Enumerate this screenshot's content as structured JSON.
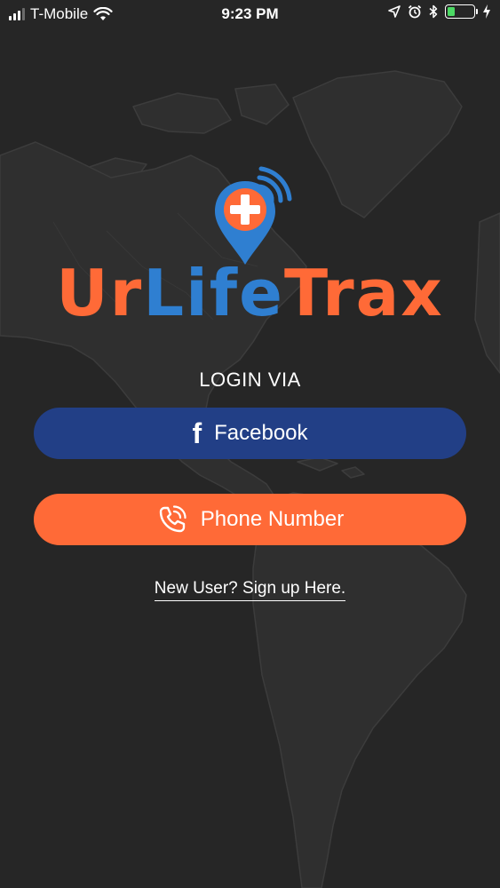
{
  "status_bar": {
    "carrier": "T-Mobile",
    "time": "9:23 PM",
    "battery_level": 0.3,
    "icons": [
      "signal-icon",
      "wifi-icon",
      "location-arrow-icon",
      "alarm-icon",
      "bluetooth-icon",
      "battery-icon",
      "charging-bolt-icon"
    ]
  },
  "logo": {
    "part1": "Ur",
    "part2": "Life",
    "part3": "Trax",
    "icon": "location-pin-plus-icon"
  },
  "colors": {
    "background": "#262626",
    "orange": "#ff6a37",
    "blue": "#2f7fd1",
    "facebook_blue": "#223f86",
    "battery_green": "#4cd964"
  },
  "login": {
    "heading": "LOGIN VIA",
    "facebook_label": "Facebook",
    "facebook_icon": "facebook-icon",
    "phone_label": "Phone Number",
    "phone_icon": "phone-icon",
    "signup_link": "New User? Sign up Here."
  }
}
